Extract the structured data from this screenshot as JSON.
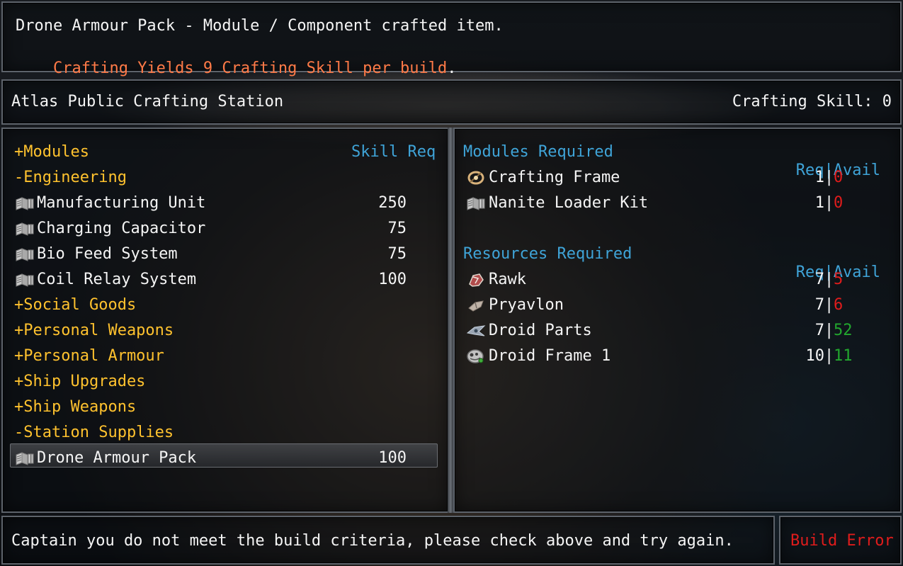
{
  "header": {
    "line1": "Drone Armour Pack - Module / Component crafted item.",
    "line2_colored": "Crafting Yields 9 Crafting Skill per build",
    "line2_suffix": "."
  },
  "station": {
    "name": "Atlas Public Crafting Station",
    "skill_label": "Crafting Skill: 0"
  },
  "left_panel": {
    "header_category": "+Modules",
    "header_skill": "Skill Req",
    "rows": [
      {
        "label": "-Engineering",
        "kind": "category"
      },
      {
        "label": "Manufacturing Unit",
        "skill": "250",
        "kind": "item",
        "icon": "module-icon"
      },
      {
        "label": "Charging Capacitor",
        "skill": "75",
        "kind": "item",
        "icon": "module-icon"
      },
      {
        "label": "Bio Feed System",
        "skill": "75",
        "kind": "item",
        "icon": "module-icon"
      },
      {
        "label": "Coil Relay System",
        "skill": "100",
        "kind": "item",
        "icon": "module-icon"
      },
      {
        "label": "+Social Goods",
        "kind": "category"
      },
      {
        "label": "+Personal Weapons",
        "kind": "category"
      },
      {
        "label": "+Personal Armour",
        "kind": "category"
      },
      {
        "label": "+Ship Upgrades",
        "kind": "category"
      },
      {
        "label": "+Ship Weapons",
        "kind": "category"
      },
      {
        "label": "-Station Supplies",
        "kind": "category"
      },
      {
        "label": "Drone Armour Pack",
        "skill": "100",
        "kind": "item",
        "icon": "module-icon",
        "selected": true
      }
    ]
  },
  "right_panel": {
    "modules_header": "Modules Required",
    "req_label": "Req",
    "sep": "|",
    "avail_label": "Avail",
    "modules": [
      {
        "label": "Crafting Frame",
        "req": "1",
        "avail": "0",
        "avail_color": "#e01c1c",
        "icon": "crafting-frame-icon"
      },
      {
        "label": "Nanite Loader Kit",
        "req": "1",
        "avail": "0",
        "avail_color": "#e01c1c",
        "icon": "module-icon"
      }
    ],
    "resources_header": "Resources Required",
    "resources": [
      {
        "label": "Rawk",
        "req": "7",
        "avail": "5",
        "avail_color": "#e01c1c",
        "icon": "rawk-icon"
      },
      {
        "label": "Pryavlon",
        "req": "7",
        "avail": "6",
        "avail_color": "#e01c1c",
        "icon": "pryavlon-icon"
      },
      {
        "label": "Droid Parts",
        "req": "7",
        "avail": "52",
        "avail_color": "#22a82e",
        "icon": "droid-parts-icon"
      },
      {
        "label": "Droid Frame 1",
        "req": "10",
        "avail": "11",
        "avail_color": "#22a82e",
        "icon": "droid-frame-icon"
      }
    ]
  },
  "footer": {
    "message": "Captain you do not meet the build criteria, please check above and try again.",
    "button": "Build Error"
  },
  "colors": {
    "category": "#ffc22e",
    "header_blue": "#3fa4d8",
    "error_red": "#e01c1c",
    "ok_green": "#22a82e",
    "yield_orange": "#ff7a47"
  }
}
